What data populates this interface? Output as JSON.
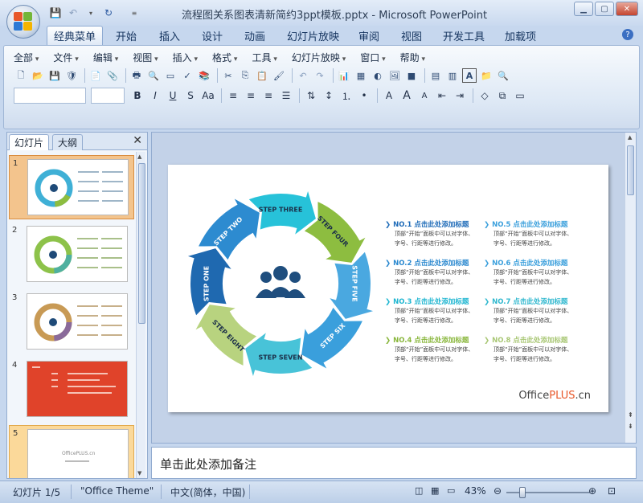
{
  "window": {
    "title": "流程图关系图表清新简约3ppt模板.pptx - Microsoft PowerPoint"
  },
  "ribbon_tabs": [
    "经典菜单",
    "开始",
    "插入",
    "设计",
    "动画",
    "幻灯片放映",
    "审阅",
    "视图",
    "开发工具",
    "加载项"
  ],
  "active_tab": "经典菜单",
  "classic_menu": [
    "全部",
    "文件",
    "编辑",
    "视图",
    "插入",
    "格式",
    "工具",
    "幻灯片放映",
    "窗口",
    "帮助"
  ],
  "toolbar": {
    "bold": "B",
    "italic": "I",
    "underline": "U",
    "shadow": "S",
    "case": "Aa",
    "font_grow": "A",
    "font_shrink": "A"
  },
  "left_pane": {
    "tabs": [
      "幻灯片",
      "大纲"
    ],
    "active_tab": "幻灯片",
    "thumbnails": [
      {
        "number": "1",
        "selected": true
      },
      {
        "number": "2",
        "selected": false
      },
      {
        "number": "3",
        "selected": false
      },
      {
        "number": "4",
        "selected": false
      },
      {
        "number": "5",
        "selected": false
      }
    ],
    "thumb5_logo": "OfficePLUS.cn"
  },
  "slide": {
    "steps": [
      "STEP ONE",
      "STEP TWO",
      "STEP THREE",
      "STEP FOUR",
      "STEP FIVE",
      "STEP SIX",
      "STEP SEVEN",
      "STEP EIGHT"
    ],
    "step_colors": [
      "#1f69b0",
      "#2d8bd0",
      "#27c2d9",
      "#8dbd40",
      "#4aa8e0",
      "#3a9fdc",
      "#48c3d8",
      "#b8d37f"
    ],
    "center_icon": "people-group-icon",
    "items": [
      {
        "title": "NO.1 点击此处添加标题",
        "line1": "顶部“开始”面板中可以对字体、",
        "line2": "字号、行距等进行修改。",
        "color": "#1e6bb8"
      },
      {
        "title": "NO.2 点击此处添加标题",
        "line1": "顶部“开始”面板中可以对字体、",
        "line2": "字号、行距等进行修改。",
        "color": "#2a88cf"
      },
      {
        "title": "NO.3 点击此处添加标题",
        "line1": "顶部“开始”面板中可以对字体、",
        "line2": "字号、行距等进行修改。",
        "color": "#1fb6d1"
      },
      {
        "title": "NO.4 点击此处添加标题",
        "line1": "顶部“开始”面板中可以对字体、",
        "line2": "字号、行距等进行修改。",
        "color": "#88b63a"
      },
      {
        "title": "NO.5 点击此处添加标题",
        "line1": "顶部“开始”面板中可以对字体、",
        "line2": "字号、行距等进行修改。",
        "color": "#3a9fdc"
      },
      {
        "title": "NO.6 点击此处添加标题",
        "line1": "顶部“开始”面板中可以对字体、",
        "line2": "字号、行距等进行修改。",
        "color": "#3a9fdc"
      },
      {
        "title": "NO.7 点击此处添加标题",
        "line1": "顶部“开始”面板中可以对字体、",
        "line2": "字号、行距等进行修改。",
        "color": "#30b8cf"
      },
      {
        "title": "NO.8 点击此处添加标题",
        "line1": "顶部“开始”面板中可以对字体、",
        "line2": "字号、行距等进行修改。",
        "color": "#a9c775"
      }
    ],
    "logo_office": "Office",
    "logo_plus": "PLUS",
    "logo_cn": ".cn"
  },
  "notes_placeholder": "单击此处添加备注",
  "status": {
    "slide_info": "幻灯片 1/5",
    "theme": "\"Office Theme\"",
    "language": "中文(简体，中国)",
    "zoom": "43%"
  }
}
